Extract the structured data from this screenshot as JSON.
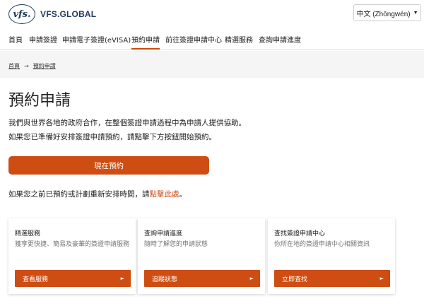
{
  "header": {
    "logo_mark": "vfs.",
    "brand": "VFS.GLOBAL",
    "language": "中文 (Zhōngwén)"
  },
  "nav": {
    "items": [
      "首頁",
      "申請簽證",
      "申請電子簽證(eVISA)",
      "預約申請",
      "前往簽證申請中心",
      "精選服務",
      "查詢申請進度"
    ],
    "active": "預約申請"
  },
  "breadcrumb": {
    "home": "首頁",
    "current": "預約申請"
  },
  "main": {
    "title": "預約申請",
    "intro_line1": "我們與世界各地的政府合作，在整個簽證申請過程中為申請人提供協助。",
    "intro_line2": "如果您已準備好安排簽證申請預約，請點擊下方按鈕開始預約。",
    "cta_label": "現在預約",
    "reschedule_text": "如果您之前已預約或計劃重新安排時間，請",
    "reschedule_link": "點擊此處",
    "reschedule_end": "。"
  },
  "cards": [
    {
      "title": "精選服務",
      "desc": "獲享更快捷、簡易及豪華的簽證申請服務",
      "button": "查看服務"
    },
    {
      "title": "查詢申請進度",
      "desc": "隨時了解您的申請狀態",
      "button": "追蹤狀態"
    },
    {
      "title": "查找簽證申請中心",
      "desc": "你所在地的簽證申請中心相關資訊",
      "button": "立即查找"
    }
  ],
  "colors": {
    "accent": "#ce4d12",
    "brand_navy": "#1f3a5c",
    "crumb_bg": "#f5f5f5"
  }
}
